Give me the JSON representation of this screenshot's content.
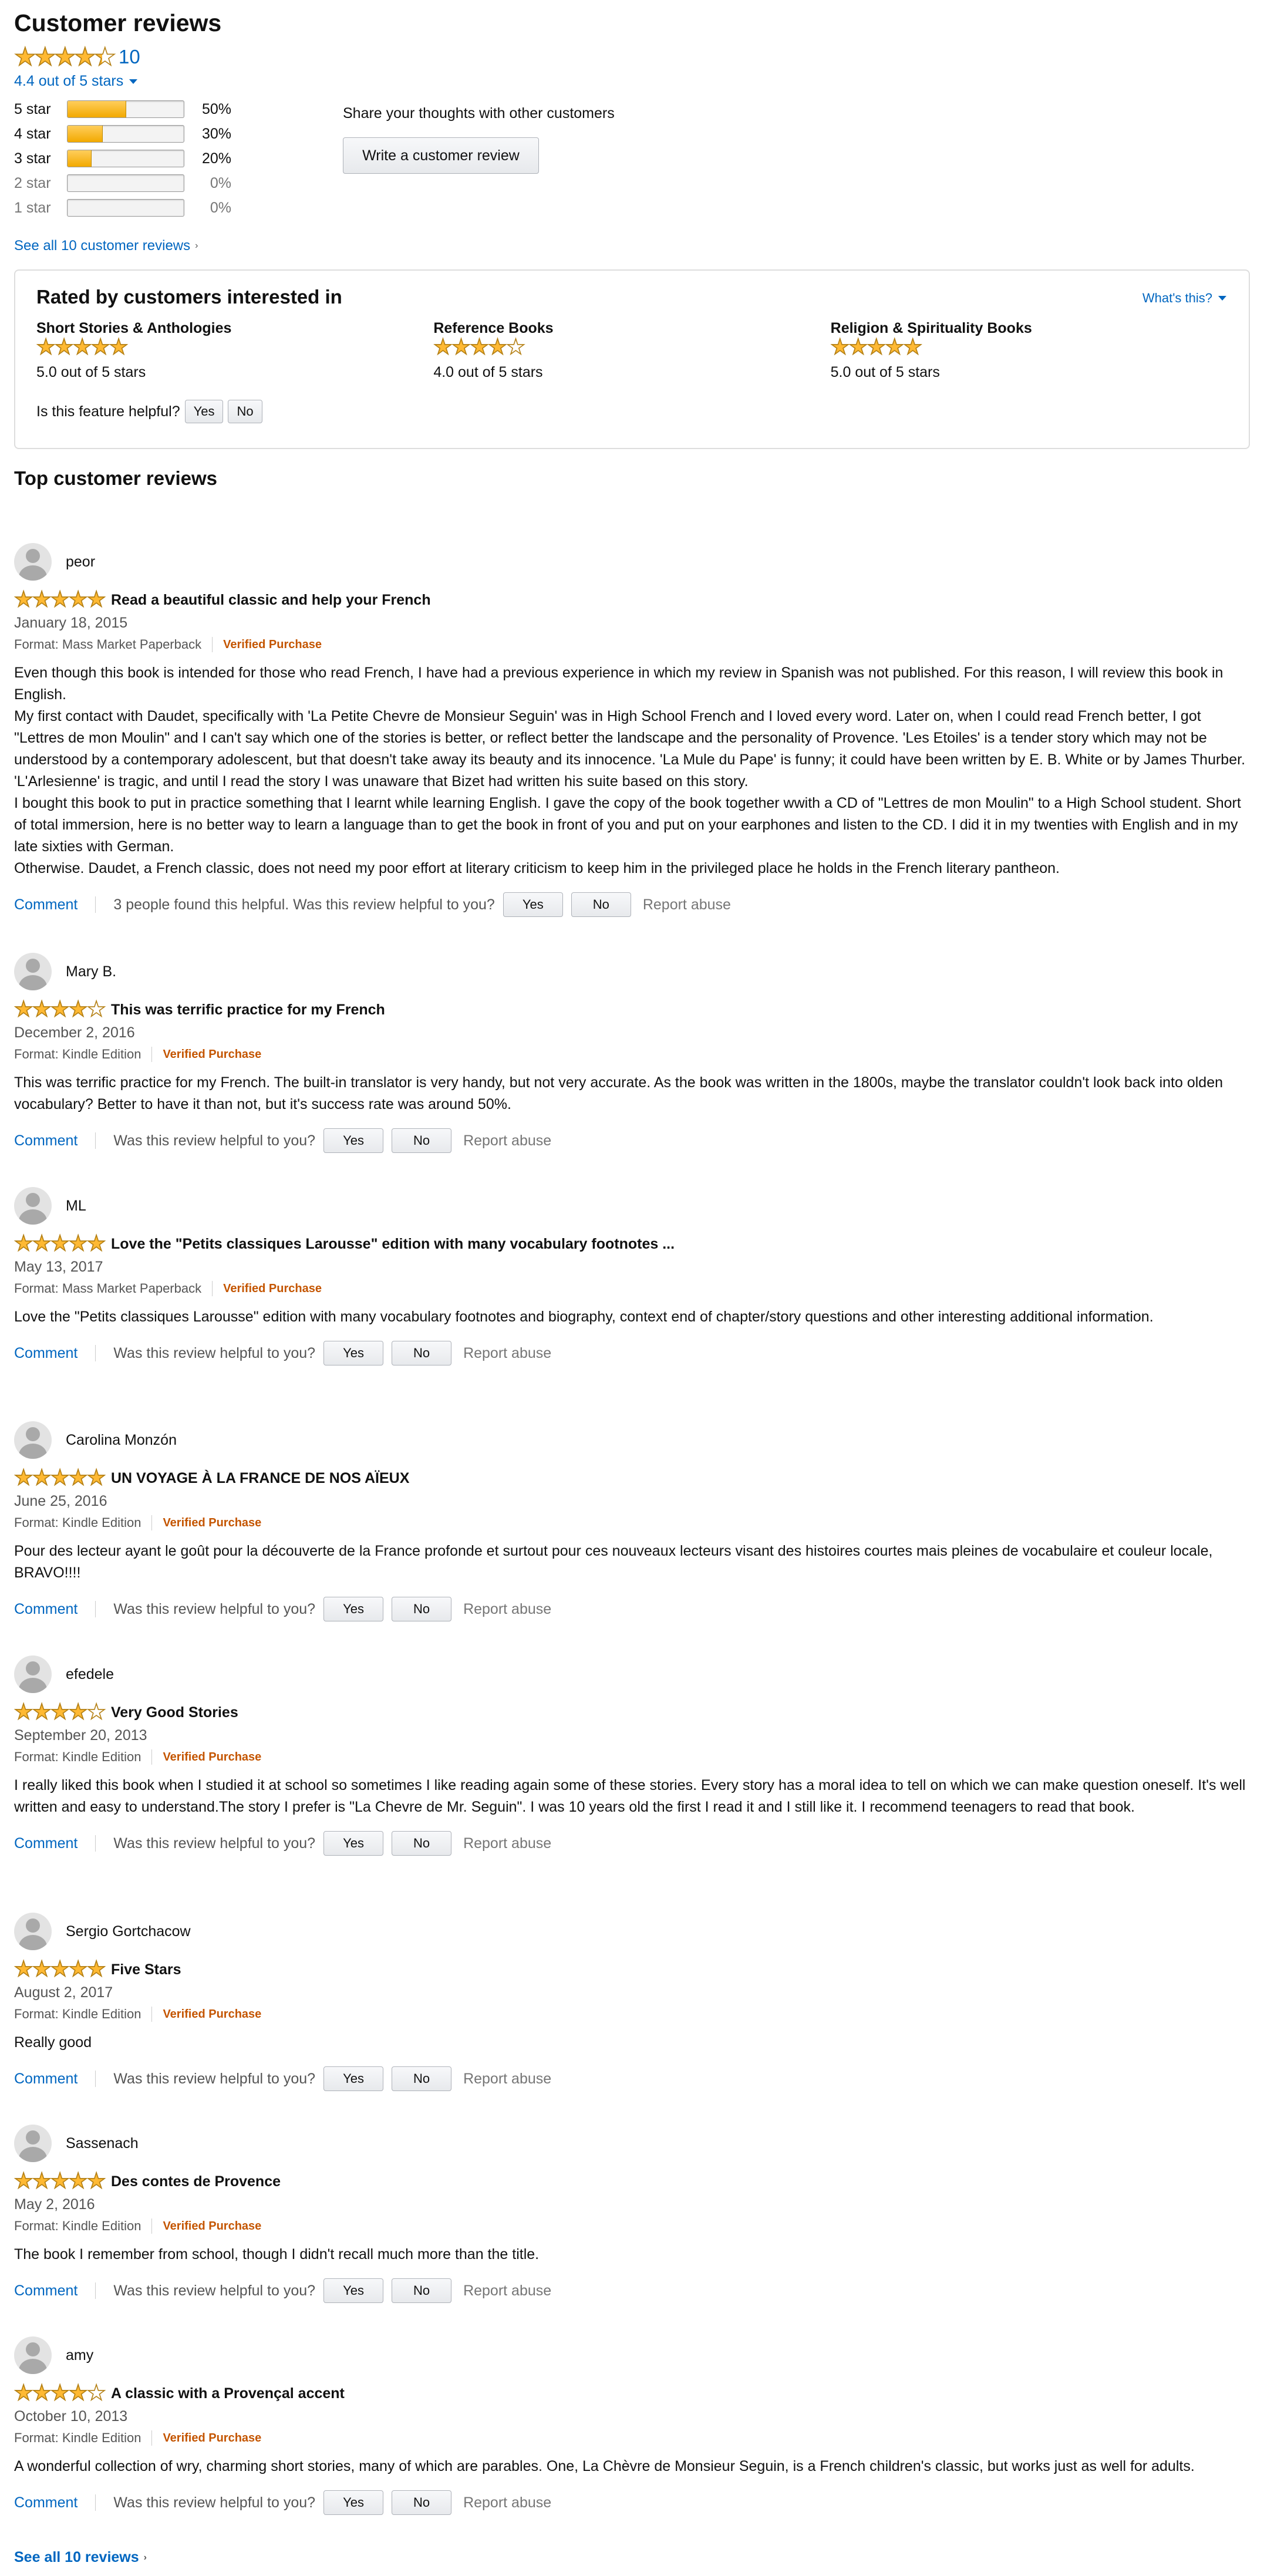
{
  "header": {
    "title": "Customer reviews"
  },
  "summary": {
    "rating": 4.4,
    "count": "10",
    "out_of": "4.4 out of 5 stars"
  },
  "histogram": [
    {
      "label": "5 star",
      "pct": "50%",
      "value": 50,
      "active": true
    },
    {
      "label": "4 star",
      "pct": "30%",
      "value": 30,
      "active": true
    },
    {
      "label": "3 star",
      "pct": "20%",
      "value": 20,
      "active": true
    },
    {
      "label": "2 star",
      "pct": "0%",
      "value": 0,
      "active": false
    },
    {
      "label": "1 star",
      "pct": "0%",
      "value": 0,
      "active": false
    }
  ],
  "share": {
    "text": "Share your thoughts with other customers",
    "button": "Write a customer review"
  },
  "see_all_top": "See all 10 customer reviews",
  "rated_by": {
    "title": "Rated by customers interested in",
    "whats_this": "What's this?",
    "categories": [
      {
        "name": "Short Stories & Anthologies",
        "rating": 5.0,
        "text": "5.0 out of 5 stars"
      },
      {
        "name": "Reference Books",
        "rating": 4.0,
        "text": "4.0 out of 5 stars"
      },
      {
        "name": "Religion & Spirituality Books",
        "rating": 5.0,
        "text": "5.0 out of 5 stars"
      }
    ],
    "helpful_question": "Is this feature helpful?",
    "yes": "Yes",
    "no": "No"
  },
  "top_reviews_title": "Top customer reviews",
  "labels": {
    "comment": "Comment",
    "helpful_q": "Was this review helpful to you?",
    "yes": "Yes",
    "no": "No",
    "report": "Report abuse",
    "verified": "Verified Purchase"
  },
  "reviews": [
    {
      "name": "peor",
      "rating": 5,
      "title": "Read a beautiful classic and help your French",
      "date": "January 18, 2015",
      "format": "Format: Mass Market Paperback",
      "body": [
        "Even though this book is intended for those who read French, I have had a previous experience in which my review in Spanish was not published. For this reason, I will review this book in English.",
        "My first contact with Daudet, specifically with 'La Petite Chevre de Monsieur Seguin' was in High School French and I loved every word. Later on, when I could read French better, I got \"Lettres de mon Moulin\" and I can't say which one of the stories is better, or reflect better the landscape and the personality of Provence. 'Les Etoiles' is a tender story which may not be understood by a contemporary adolescent, but that doesn't take away its beauty and its innocence. 'La Mule du Pape' is funny; it could have been written by E. B. White or by James Thurber. 'L'Arlesienne' is tragic, and until I read the story I was unaware that Bizet had written his suite based on this story.",
        "I bought this book to put in practice something that I learnt while learning English. I gave the copy of the book together wwith a CD of \"Lettres de mon Moulin\" to a High School student. Short of total immersion, here is no better way to learn a language than to get the book in front of you and put on your earphones and listen to the CD. I did it in my twenties with English and in my late sixties with German.",
        "Otherwise. Daudet, a French classic, does not need my poor effort at literary criticism to keep him in the privileged place he holds in the French literary pantheon."
      ],
      "helpful": "3 people found this helpful. Was this review helpful to you?"
    },
    {
      "name": "Mary B.",
      "rating": 4,
      "title": "This was terrific practice for my French",
      "date": "December 2, 2016",
      "format": "Format: Kindle Edition",
      "body": [
        "This was terrific practice for my French. The built-in translator is very handy, but not very accurate. As the book was written in the 1800s, maybe the translator couldn't look back into olden vocabulary? Better to have it than not, but it's success rate was around 50%."
      ]
    },
    {
      "name": "ML",
      "rating": 5,
      "title": "Love the \"Petits classiques Larousse\" edition with many vocabulary footnotes ...",
      "date": "May 13, 2017",
      "format": "Format: Mass Market Paperback",
      "body": [
        "Love the \"Petits classiques Larousse\" edition with many vocabulary footnotes and biography, context end of chapter/story questions and other interesting additional information."
      ]
    },
    {
      "name": "Carolina Monzón",
      "rating": 5,
      "title": "UN VOYAGE À LA FRANCE DE NOS AÏEUX",
      "date": "June 25, 2016",
      "format": "Format: Kindle Edition",
      "body": [
        "Pour des lecteur ayant le goût pour la découverte de la France profonde et surtout pour ces nouveaux lecteurs visant des histoires courtes mais pleines de vocabulaire et couleur locale, BRAVO!!!!"
      ]
    },
    {
      "name": "efedele",
      "rating": 4,
      "title": "Very Good Stories",
      "date": "September 20, 2013",
      "format": "Format: Kindle Edition",
      "body": [
        "I really liked this book when I studied it at school so sometimes I like reading again some of these stories. Every story has a moral idea to tell on which we can make question oneself. It's well written and easy to understand.The story I prefer is \"La Chevre de Mr. Seguin\". I was 10 years old the first I read it and I still like it. I recommend teenagers to read that book."
      ]
    },
    {
      "name": "Sergio Gortchacow",
      "rating": 5,
      "title": "Five Stars",
      "date": "August 2, 2017",
      "format": "Format: Kindle Edition",
      "body": [
        "Really good"
      ]
    },
    {
      "name": "Sassenach",
      "rating": 5,
      "title": "Des contes de Provence",
      "date": "May 2, 2016",
      "format": "Format: Kindle Edition",
      "body": [
        "The book I remember from school, though I didn't recall much more than the title."
      ]
    },
    {
      "name": "amy",
      "rating": 4,
      "title": "A classic with a Provençal accent",
      "date": "October 10, 2013",
      "format": "Format: Kindle Edition",
      "body": [
        "A wonderful collection of wry, charming short stories, many of which are parables. One, La Chèvre de Monsieur Seguin, is a French children's classic, but works just as well for adults."
      ]
    }
  ],
  "see_all_bottom": "See all 10 reviews"
}
